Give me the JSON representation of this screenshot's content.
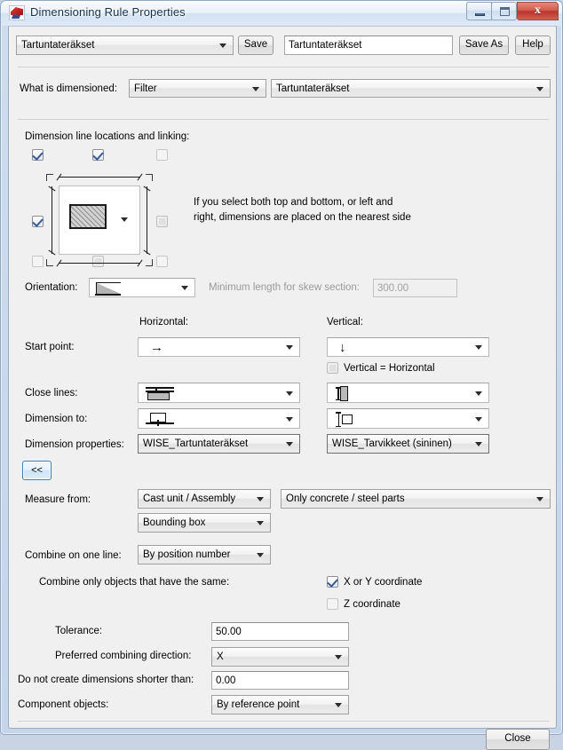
{
  "window": {
    "title": "Dimensioning Rule Properties",
    "icon": "app-icon",
    "minimize_label": "",
    "maximize_label": "",
    "close_label": "x"
  },
  "toolbar": {
    "rule_select_value": "Tartuntateräkset",
    "save_label": "Save",
    "name_value": "Tartuntateräkset",
    "save_as_label": "Save As",
    "help_label": "Help"
  },
  "what_is_dimensioned": {
    "label": "What is dimensioned:",
    "type_value": "Filter",
    "target_value": "Tartuntateräkset"
  },
  "dimension_lines": {
    "label": "Dimension line locations and linking:",
    "hint": "If you select both top and bottom, or left and\nright, dimensions are placed on the nearest side",
    "hint_line1": "If you select both top and bottom, or left and",
    "hint_line2": "right, dimensions are placed on the nearest side",
    "checkboxes": [
      {
        "name": "top-left-outer",
        "checked": true,
        "disabled": false
      },
      {
        "name": "top-center",
        "checked": true,
        "disabled": false
      },
      {
        "name": "top-right-outer",
        "checked": false,
        "disabled": false
      },
      {
        "name": "middle-left",
        "checked": true,
        "disabled": false
      },
      {
        "name": "middle-right",
        "checked": false,
        "disabled": true
      },
      {
        "name": "bottom-left-outer",
        "checked": false,
        "disabled": false
      },
      {
        "name": "bottom-center",
        "checked": false,
        "disabled": true
      },
      {
        "name": "bottom-right-outer",
        "checked": false,
        "disabled": false
      }
    ]
  },
  "orientation": {
    "label": "Orientation:",
    "value_icon": "skew-triangle-icon",
    "min_skew_label": "Minimum length for skew section:",
    "min_skew_value": "300.00",
    "min_skew_enabled": false
  },
  "columns": {
    "horizontal_label": "Horizontal:",
    "vertical_label": "Vertical:"
  },
  "start_point": {
    "label": "Start point:",
    "horizontal_icon": "arrow-right-icon",
    "horizontal_glyph": "→",
    "vertical_icon": "arrow-down-icon",
    "vertical_glyph": "↓",
    "vertical_equals_horizontal_label": "Vertical = Horizontal",
    "vertical_equals_horizontal_checked": false,
    "vertical_equals_horizontal_disabled": true
  },
  "close_lines": {
    "label": "Close lines:",
    "horizontal_icon": "close-lines-horizontal-icon",
    "vertical_icon": "close-lines-vertical-icon"
  },
  "dimension_to": {
    "label": "Dimension to:",
    "horizontal_icon": "dimension-to-horizontal-icon",
    "vertical_icon": "dimension-to-vertical-icon"
  },
  "dimension_properties": {
    "label": "Dimension properties:",
    "horizontal_value": "WISE_Tartuntateräkset",
    "vertical_value": "WISE_Tarvikkeet (sininen)"
  },
  "collapse_button": {
    "label": "<<"
  },
  "measure_from": {
    "label": "Measure from:",
    "primary_value": "Cast unit / Assembly",
    "parts_value": "Only concrete / steel parts",
    "secondary_value": "Bounding box"
  },
  "combine": {
    "label": "Combine on one line:",
    "value": "By position number",
    "same_label": "Combine only objects that have the same:",
    "xy_label": "X or Y coordinate",
    "xy_checked": true,
    "z_label": "Z coordinate",
    "z_checked": false
  },
  "tolerance": {
    "label": "Tolerance:",
    "value": "50.00"
  },
  "preferred_direction": {
    "label": "Preferred combining direction:",
    "value": "X"
  },
  "min_dimension": {
    "label": "Do not create dimensions shorter than:",
    "value": "0.00"
  },
  "component_objects": {
    "label": "Component objects:",
    "value": "By reference point"
  },
  "footer": {
    "close_label": "Close"
  },
  "colors": {
    "dialog_bg": "#f0f0f0",
    "frame": "#c8d4e4",
    "title_text": "#16334f",
    "close_button": "#b8352a",
    "focus_border": "#3c7fb1",
    "disabled_text": "#9a9a9a"
  }
}
